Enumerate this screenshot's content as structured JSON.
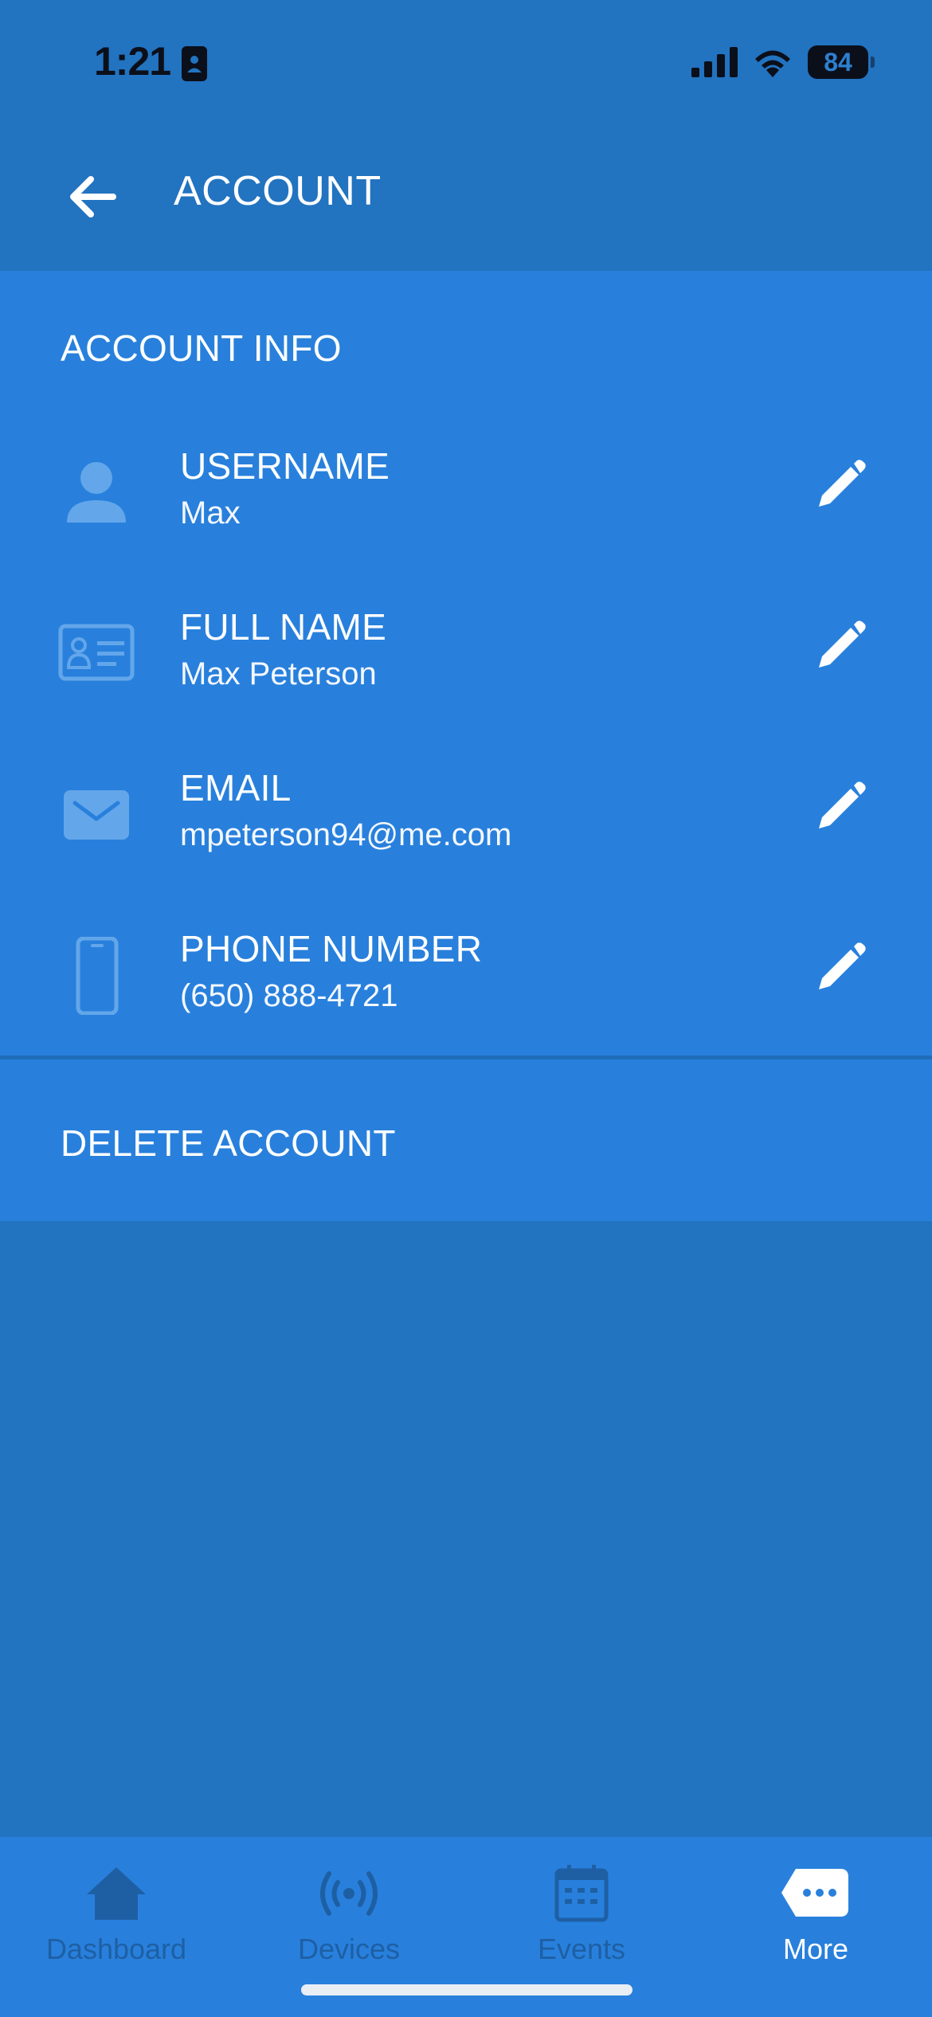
{
  "status_bar": {
    "time": "1:21",
    "battery": "84"
  },
  "header": {
    "title": "ACCOUNT"
  },
  "account_info": {
    "section_title": "ACCOUNT INFO",
    "rows": [
      {
        "label": "USERNAME",
        "value": "Max",
        "icon": "person-icon"
      },
      {
        "label": "FULL NAME",
        "value": "Max Peterson",
        "icon": "id-card-icon"
      },
      {
        "label": "EMAIL",
        "value": "mpeterson94@me.com",
        "icon": "envelope-icon"
      },
      {
        "label": "PHONE NUMBER",
        "value": "(650) 888-4721",
        "icon": "phone-icon"
      }
    ]
  },
  "delete": {
    "label": "DELETE ACCOUNT"
  },
  "tabs": [
    {
      "label": "Dashboard",
      "icon": "home-icon",
      "active": false
    },
    {
      "label": "Devices",
      "icon": "broadcast-icon",
      "active": false
    },
    {
      "label": "Events",
      "icon": "calendar-icon",
      "active": false
    },
    {
      "label": "More",
      "icon": "more-icon",
      "active": true
    }
  ],
  "colors": {
    "background": "#2273c0",
    "card": "#2880dc",
    "inactive_tab": "#1e5fa4",
    "icon_muted": "#63a6ea"
  }
}
